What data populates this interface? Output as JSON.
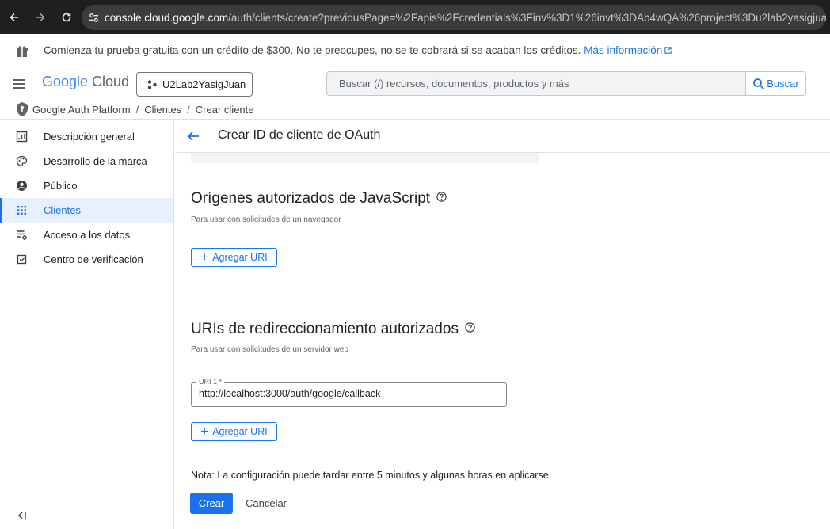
{
  "browser": {
    "url_host": "console.cloud.google.com",
    "url_path": "/auth/clients/create?previousPage=%2Fapis%2Fcredentials%3Finv%3D1%26invt%3DAb4wQA%26project%3Du2lab2yasigjuan&inv=1&invt=A..."
  },
  "banner": {
    "text": "Comienza tu prueba gratuita con un crédito de $300. No te preocupes, no se te cobrará si se acaban los créditos.",
    "link": "Más información"
  },
  "header": {
    "logo_google": "Google",
    "logo_cloud": "Cloud",
    "project": "U2Lab2YasigJuan",
    "search_placeholder": "Buscar (/) recursos, documentos, productos y más",
    "search_button": "Buscar"
  },
  "breadcrumb": {
    "items": [
      "Google Auth Platform",
      "Clientes",
      "Crear cliente"
    ],
    "separator": "/"
  },
  "sidebar": {
    "items": [
      {
        "label": "Descripción general",
        "icon": "dashboard-icon"
      },
      {
        "label": "Desarrollo de la marca",
        "icon": "palette-icon"
      },
      {
        "label": "Público",
        "icon": "person-icon"
      },
      {
        "label": "Clientes",
        "icon": "grid-icon",
        "active": true
      },
      {
        "label": "Acceso a los datos",
        "icon": "data-access-icon"
      },
      {
        "label": "Centro de verificación",
        "icon": "verified-icon"
      }
    ]
  },
  "main": {
    "title": "Crear ID de cliente de OAuth",
    "js_origins": {
      "title": "Orígenes autorizados de JavaScript",
      "subtitle": "Para usar con solicitudes de un navegador",
      "add_label": "Agregar URI"
    },
    "redirect": {
      "title": "URIs de redireccionamiento autorizados",
      "subtitle": "Para usar con solicitudes de un servidor web",
      "field_label": "URI 1 *",
      "field_value": "http://localhost:3000/auth/google/callback",
      "add_label": "Agregar URI"
    },
    "note": "Nota: La configuración puede tardar entre 5 minutos y algunas horas en aplicarse",
    "create_label": "Crear",
    "cancel_label": "Cancelar"
  },
  "colors": {
    "accent": "#1a73e8",
    "active_bg": "#e8f0fe"
  }
}
